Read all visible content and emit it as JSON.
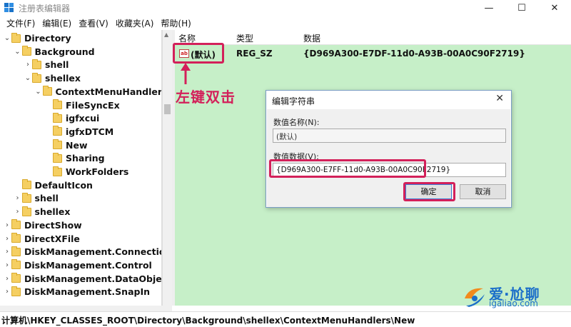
{
  "window": {
    "title": "注册表编辑器",
    "minimize_glyph": "—",
    "maximize_glyph": "☐",
    "close_glyph": "✕"
  },
  "menu": [
    "文件(F)",
    "编辑(E)",
    "查看(V)",
    "收藏夹(A)",
    "帮助(H)"
  ],
  "tree": [
    {
      "label": "Directory",
      "level": 0,
      "expander": "⌄"
    },
    {
      "label": "Background",
      "level": 1,
      "expander": "⌄"
    },
    {
      "label": "shell",
      "level": 2,
      "expander": "›"
    },
    {
      "label": "shellex",
      "level": 2,
      "expander": "⌄"
    },
    {
      "label": "ContextMenuHandlers",
      "level": 3,
      "expander": "⌄"
    },
    {
      "label": "FileSyncEx",
      "level": 4,
      "expander": ""
    },
    {
      "label": "igfxcui",
      "level": 4,
      "expander": ""
    },
    {
      "label": "igfxDTCM",
      "level": 4,
      "expander": ""
    },
    {
      "label": "New",
      "level": 4,
      "expander": ""
    },
    {
      "label": "Sharing",
      "level": 4,
      "expander": ""
    },
    {
      "label": "WorkFolders",
      "level": 4,
      "expander": ""
    },
    {
      "label": "DefaultIcon",
      "level": 1,
      "expander": ""
    },
    {
      "label": "shell",
      "level": 1,
      "expander": "›"
    },
    {
      "label": "shellex",
      "level": 1,
      "expander": "›"
    },
    {
      "label": "DirectShow",
      "level": 0,
      "expander": "›"
    },
    {
      "label": "DirectXFile",
      "level": 0,
      "expander": "›"
    },
    {
      "label": "DiskManagement.Connection",
      "level": 0,
      "expander": "›"
    },
    {
      "label": "DiskManagement.Control",
      "level": 0,
      "expander": "›"
    },
    {
      "label": "DiskManagement.DataObject",
      "level": 0,
      "expander": "›"
    },
    {
      "label": "DiskManagement.SnapIn",
      "level": 0,
      "expander": "›"
    }
  ],
  "list": {
    "columns": {
      "name": "名称",
      "type": "类型",
      "data": "数据"
    },
    "rows": [
      {
        "icon": "ab",
        "name": "(默认)",
        "type": "REG_SZ",
        "data": "{D969A300-E7DF-11d0-A93B-00A0C90F2719}"
      }
    ]
  },
  "annotation": {
    "text": "左键双击"
  },
  "dialog": {
    "title": "编辑字符串",
    "name_label": "数值名称(N):",
    "name_value": "(默认)",
    "data_label": "数值数据(V):",
    "data_value": "{D969A300-E7FF-11d0-A93B-00A0C90F2719}",
    "ok_label": "确定",
    "cancel_label": "取消"
  },
  "status": {
    "path": "计算机\\HKEY_CLASSES_ROOT\\Directory\\Background\\shellex\\ContextMenuHandlers\\New"
  },
  "watermark": {
    "title": "爱·尬聊",
    "url": "igaliao.com"
  },
  "colors": {
    "highlight": "#d3205a",
    "list_bg": "#c6efc8",
    "watermark": "#1c6fc9"
  }
}
